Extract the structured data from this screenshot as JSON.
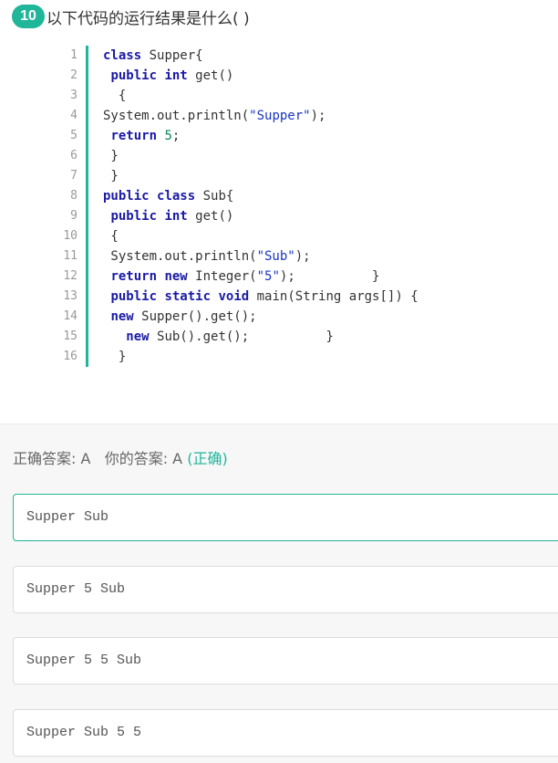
{
  "question": {
    "number": "10",
    "text": "以下代码的运行结果是什么( )"
  },
  "code": {
    "lines": [
      {
        "n": "1",
        "tokens": [
          {
            "t": "class",
            "c": "kw"
          },
          {
            "t": " Supper{",
            "c": ""
          }
        ]
      },
      {
        "n": "2",
        "tokens": [
          {
            "t": " ",
            "c": ""
          },
          {
            "t": "public",
            "c": "kw"
          },
          {
            "t": " ",
            "c": ""
          },
          {
            "t": "int",
            "c": "kw"
          },
          {
            "t": " get()",
            "c": ""
          }
        ]
      },
      {
        "n": "3",
        "tokens": [
          {
            "t": "  {",
            "c": ""
          }
        ]
      },
      {
        "n": "4",
        "tokens": [
          {
            "t": "System.out.println(",
            "c": ""
          },
          {
            "t": "\"Supper\"",
            "c": "str"
          },
          {
            "t": ");",
            "c": ""
          }
        ]
      },
      {
        "n": "5",
        "tokens": [
          {
            "t": " ",
            "c": ""
          },
          {
            "t": "return",
            "c": "kw"
          },
          {
            "t": " ",
            "c": ""
          },
          {
            "t": "5",
            "c": "num"
          },
          {
            "t": ";",
            "c": ""
          }
        ]
      },
      {
        "n": "6",
        "tokens": [
          {
            "t": " }",
            "c": ""
          }
        ]
      },
      {
        "n": "7",
        "tokens": [
          {
            "t": " }",
            "c": ""
          }
        ]
      },
      {
        "n": "8",
        "tokens": [
          {
            "t": "public",
            "c": "kw"
          },
          {
            "t": " ",
            "c": ""
          },
          {
            "t": "class",
            "c": "kw"
          },
          {
            "t": " Sub{",
            "c": ""
          }
        ]
      },
      {
        "n": "9",
        "tokens": [
          {
            "t": " ",
            "c": ""
          },
          {
            "t": "public",
            "c": "kw"
          },
          {
            "t": " ",
            "c": ""
          },
          {
            "t": "int",
            "c": "kw"
          },
          {
            "t": " get()",
            "c": ""
          }
        ]
      },
      {
        "n": "10",
        "tokens": [
          {
            "t": " {",
            "c": ""
          }
        ]
      },
      {
        "n": "11",
        "tokens": [
          {
            "t": " System.out.println(",
            "c": ""
          },
          {
            "t": "\"Sub\"",
            "c": "str"
          },
          {
            "t": ");",
            "c": ""
          }
        ]
      },
      {
        "n": "12",
        "tokens": [
          {
            "t": " ",
            "c": ""
          },
          {
            "t": "return",
            "c": "kw"
          },
          {
            "t": " ",
            "c": ""
          },
          {
            "t": "new",
            "c": "kw"
          },
          {
            "t": " Integer(",
            "c": ""
          },
          {
            "t": "\"5\"",
            "c": "str"
          },
          {
            "t": ");          }",
            "c": ""
          }
        ]
      },
      {
        "n": "13",
        "tokens": [
          {
            "t": " ",
            "c": ""
          },
          {
            "t": "public",
            "c": "kw"
          },
          {
            "t": " ",
            "c": ""
          },
          {
            "t": "static",
            "c": "kw"
          },
          {
            "t": " ",
            "c": ""
          },
          {
            "t": "void",
            "c": "kw"
          },
          {
            "t": " main(String args[]) {",
            "c": ""
          }
        ]
      },
      {
        "n": "14",
        "tokens": [
          {
            "t": " ",
            "c": ""
          },
          {
            "t": "new",
            "c": "kw"
          },
          {
            "t": " Supper().get();",
            "c": ""
          }
        ]
      },
      {
        "n": "15",
        "tokens": [
          {
            "t": "   ",
            "c": ""
          },
          {
            "t": "new",
            "c": "kw"
          },
          {
            "t": " Sub().get();          }",
            "c": ""
          }
        ]
      },
      {
        "n": "16",
        "tokens": [
          {
            "t": "  }",
            "c": ""
          }
        ]
      }
    ]
  },
  "answer": {
    "correct_label": "正确答案: A",
    "yours_label": "你的答案: A",
    "result": "(正确)"
  },
  "options": [
    {
      "label": "Supper Sub",
      "selected": true
    },
    {
      "label": "Supper 5 Sub",
      "selected": false
    },
    {
      "label": "Supper 5 5 Sub",
      "selected": false
    },
    {
      "label": "Supper Sub 5 5",
      "selected": false
    }
  ],
  "colors": {
    "accent": "#1fb69a",
    "keyword": "#1a1aa6",
    "string": "#1a34c2",
    "number": "#098658"
  }
}
